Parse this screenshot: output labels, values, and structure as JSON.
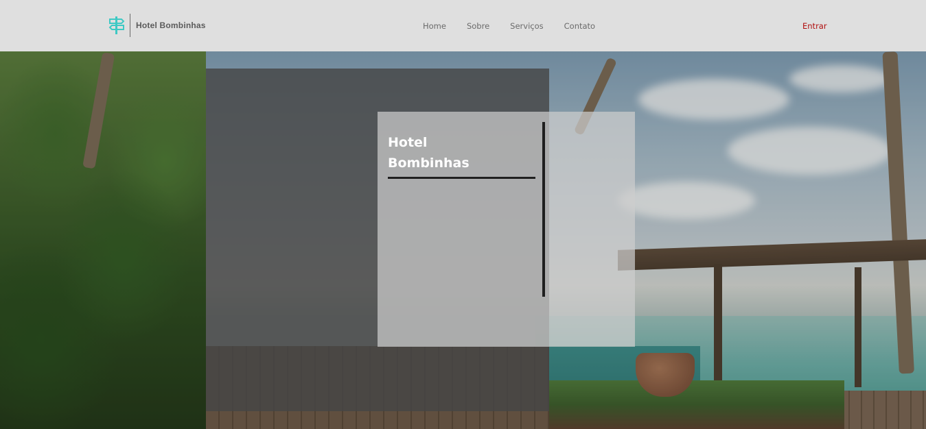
{
  "header": {
    "brand_name": "Hotel Bombinhas",
    "brand_icon": "signpost-icon",
    "nav": [
      {
        "label": "Home"
      },
      {
        "label": "Sobre"
      },
      {
        "label": "Serviços"
      },
      {
        "label": "Contato"
      }
    ],
    "login_label": "Entrar"
  },
  "hero": {
    "title_line1": "Hotel",
    "title_line2": "Bombinhas"
  },
  "colors": {
    "brand_icon": "#3ec9c4",
    "login": "#b00d0d",
    "header_bg": "#dfdfdf"
  }
}
